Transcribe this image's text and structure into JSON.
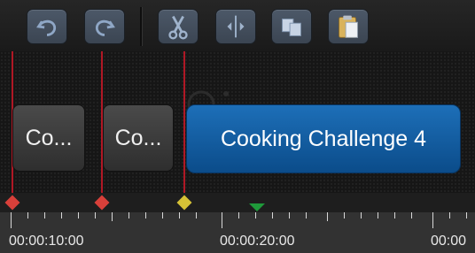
{
  "toolbar": {
    "buttons": [
      {
        "name": "undo",
        "icon": "undo-icon"
      },
      {
        "name": "redo",
        "icon": "redo-icon"
      },
      {
        "name": "cut",
        "icon": "scissors-icon"
      },
      {
        "name": "split",
        "icon": "split-icon"
      },
      {
        "name": "copy",
        "icon": "copy-icon"
      },
      {
        "name": "paste",
        "icon": "paste-icon"
      }
    ]
  },
  "callouts": [
    {
      "label": "Co...",
      "color": "#3a3a3a"
    },
    {
      "label": "Co...",
      "color": "#3a3a3a"
    },
    {
      "label": "Cooking Challenge 4",
      "color": "#0f5ea6",
      "selected": true
    }
  ],
  "markers": {
    "colors": {
      "marker": "#d8403a",
      "selected": "#d6c236",
      "playhead": "#1f9a3a",
      "line": "#b01825"
    }
  },
  "ruler": {
    "labels": [
      "00:00:10:00",
      "00:00:20:00",
      "00:00"
    ]
  }
}
